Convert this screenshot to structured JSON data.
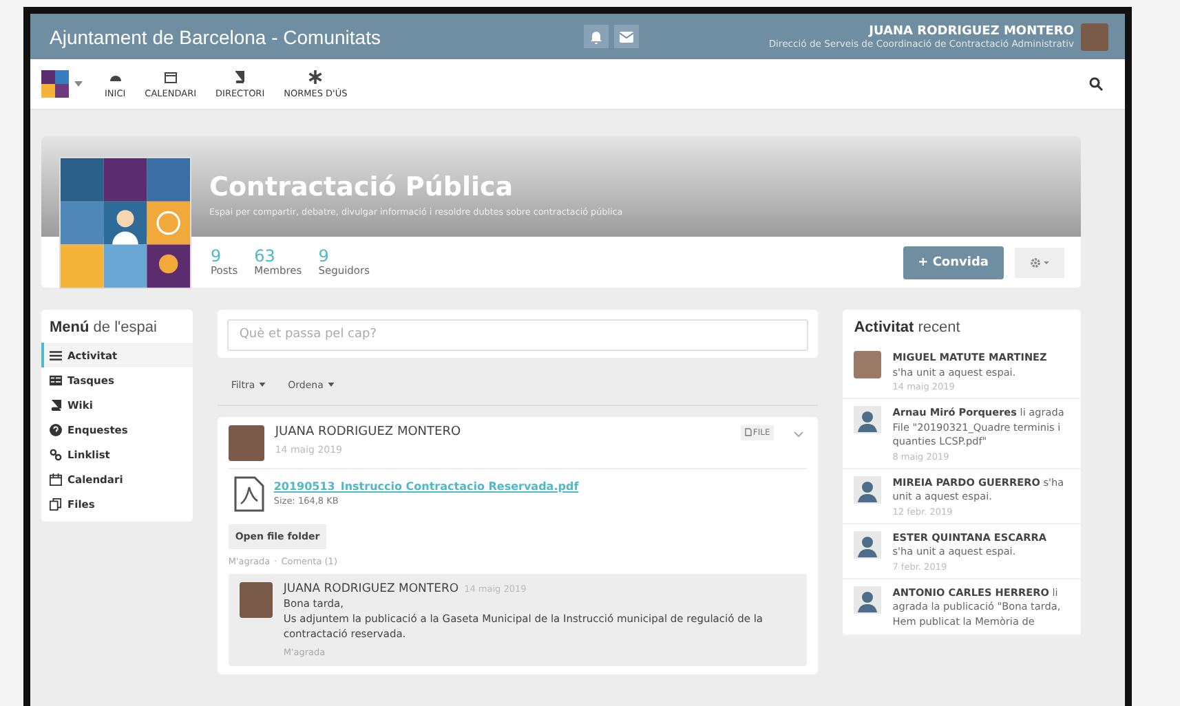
{
  "topbar": {
    "title": "Ajuntament de Barcelona - Comunitats",
    "user_name": "JUANA RODRIGUEZ MONTERO",
    "user_role": "Direcció de Serveis de Coordinació de Contractació Administrativ"
  },
  "nav": {
    "items": [
      {
        "label": "INICI"
      },
      {
        "label": "CALENDARI"
      },
      {
        "label": "DIRECTORI"
      },
      {
        "label": "NORMES D'ÚS"
      }
    ]
  },
  "space": {
    "title": "Contractació Pública",
    "description": "Espai per compartir, debatre, divulgar informació i resoldre dubtes sobre contractació pública",
    "stats": [
      {
        "value": "9",
        "label": "Posts"
      },
      {
        "value": "63",
        "label": "Membres"
      },
      {
        "value": "9",
        "label": "Seguidors"
      }
    ],
    "invite_button": "+ Convida"
  },
  "space_menu": {
    "title": "**Menú** de l'espai",
    "items": [
      {
        "label": "Activitat",
        "selected": true
      },
      {
        "label": "Tasques",
        "selected": false
      },
      {
        "label": "Wiki",
        "selected": false
      },
      {
        "label": "Enquestes",
        "selected": false
      },
      {
        "label": "Linklist",
        "selected": false
      },
      {
        "label": "Calendari",
        "selected": false
      },
      {
        "label": "Files",
        "selected": false
      }
    ]
  },
  "composer": {
    "placeholder": "Què et passa pel cap?"
  },
  "feed_filters": [
    "Filtra",
    "Ordena"
  ],
  "post": {
    "author": "JUANA RODRIGUEZ MONTERO",
    "date": "14 maig 2019",
    "badge": "FILE",
    "file_name": "20190513_Instruccio Contractacio Reservada.pdf",
    "file_size": "Size: 164,8 KB",
    "folder_button": "Open file folder",
    "actions": [
      "M'agrada",
      "Comenta (1)"
    ],
    "action_separator": "·",
    "comment": {
      "author": "JUANA RODRIGUEZ MONTERO",
      "date": "14 maig 2019",
      "lines": [
        "Bona tarda,",
        "Us adjuntem la publicació a la Gaseta Municipal de la Instrucció municipal de regulació de la contractació reservada."
      ],
      "like": "M'agrada"
    }
  },
  "recent_activity": {
    "title": "**Activitat** recent",
    "items": [
      {
        "kind": "photo",
        "text": "**MIGUEL MATUTE MARTINEZ** s'ha unit a aquest espai.",
        "date": "14 maig 2019"
      },
      {
        "kind": "silhouette",
        "text": "**Arnau Miró Porqueres** li agrada File \"20190321_Quadre terminis i quanties LCSP.pdf\"",
        "date": "8 maig 2019"
      },
      {
        "kind": "silhouette",
        "text": "**MIREIA PARDO GUERRERO** s'ha unit a aquest espai.",
        "date": "12 febr. 2019"
      },
      {
        "kind": "silhouette",
        "text": "**ESTER QUINTANA ESCARRA** s'ha unit a aquest espai.",
        "date": "7 febr. 2019"
      },
      {
        "kind": "silhouette",
        "text": "**ANTONIO CARLES HERRERO** li agrada la publicació \"Bona tarda, Hem publicat la Memòria de"
      }
    ]
  }
}
